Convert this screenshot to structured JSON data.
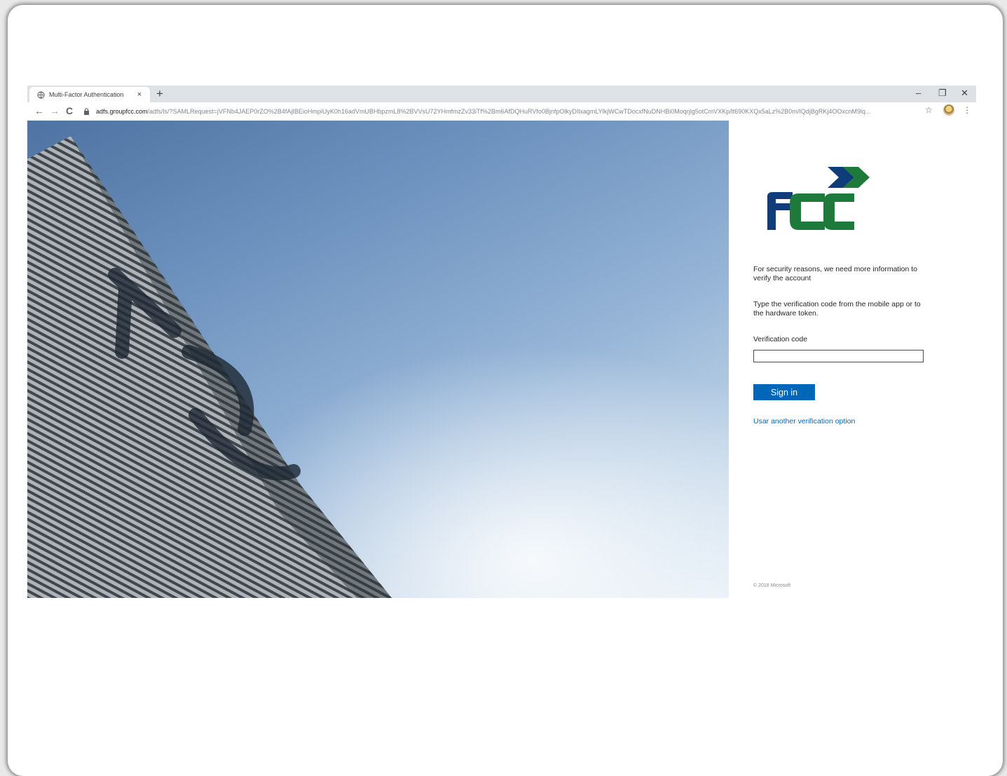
{
  "browser": {
    "tab_title": "Multi-Factor Authentication",
    "tab_close": "×",
    "new_tab": "+",
    "window_controls": {
      "minimize": "–",
      "restore": "❐",
      "close": "✕"
    },
    "nav": {
      "back": "←",
      "forward": "→",
      "reload": "C"
    },
    "url_domain": "adfs.groupfcc.com",
    "url_path": "/adfs/ls/?SAMLRequest=jVFNb4JAEP0rZO%2B4fAjIBEioHmpiUyK0h16adVmUBHbpzmL8%2BVVsU72YHmfmzZv33iTf%2Bm6AfDQHuRVfo0BjnfpOlkyDIlxagmLYlkjWCwTDocxfNuDNHBi0Moqrjlg5otCmVXKp/lt690KXQx5aLz%2B0m/IQdjBgRKj4OOxcnM9lq...",
    "star_icon": "☆",
    "menu_icon": "⋮"
  },
  "logo": {
    "primary_color": "#0f3d7a",
    "secondary_color": "#1e7a3a"
  },
  "panel": {
    "message1": "For security reasons, we need more information to verify the account",
    "message2": "Type the verification code from the mobile app or to the hardware token.",
    "verification_label": "Verification code",
    "verification_value": "",
    "sign_in_label": "Sign in",
    "alt_option_link": "Usar another verification option",
    "footer": "© 2018 Microsoft"
  },
  "colors": {
    "accent": "#0067b8"
  }
}
